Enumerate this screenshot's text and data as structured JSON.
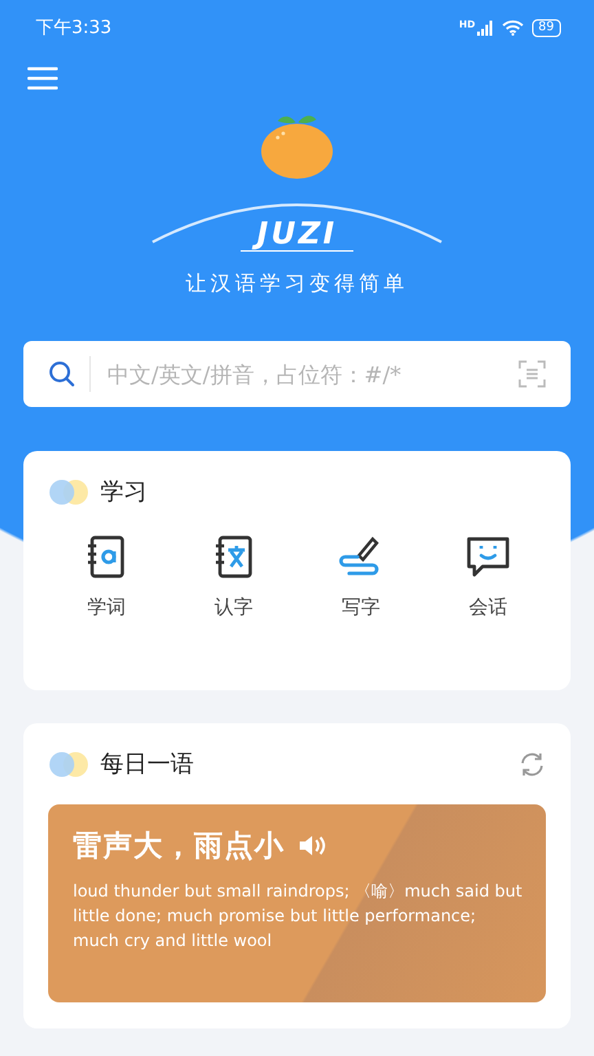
{
  "status_bar": {
    "time": "下午3:33",
    "network": "HD",
    "battery": "89"
  },
  "header": {
    "logo_text": "JUZI",
    "tagline": "让汉语学习变得简单"
  },
  "search": {
    "placeholder": "中文/英文/拼音，占位符：#/*"
  },
  "study": {
    "title": "学习",
    "items": [
      {
        "label": "学词",
        "kind": "word"
      },
      {
        "label": "认字",
        "kind": "char"
      },
      {
        "label": "写字",
        "kind": "write"
      },
      {
        "label": "会话",
        "kind": "chat"
      }
    ]
  },
  "daily": {
    "title": "每日一语",
    "phrase": "雷声大，雨点小",
    "translation": "loud thunder but small raindrops; 〈喻〉much said but little done; much promise but little performance; much cry and little wool"
  }
}
